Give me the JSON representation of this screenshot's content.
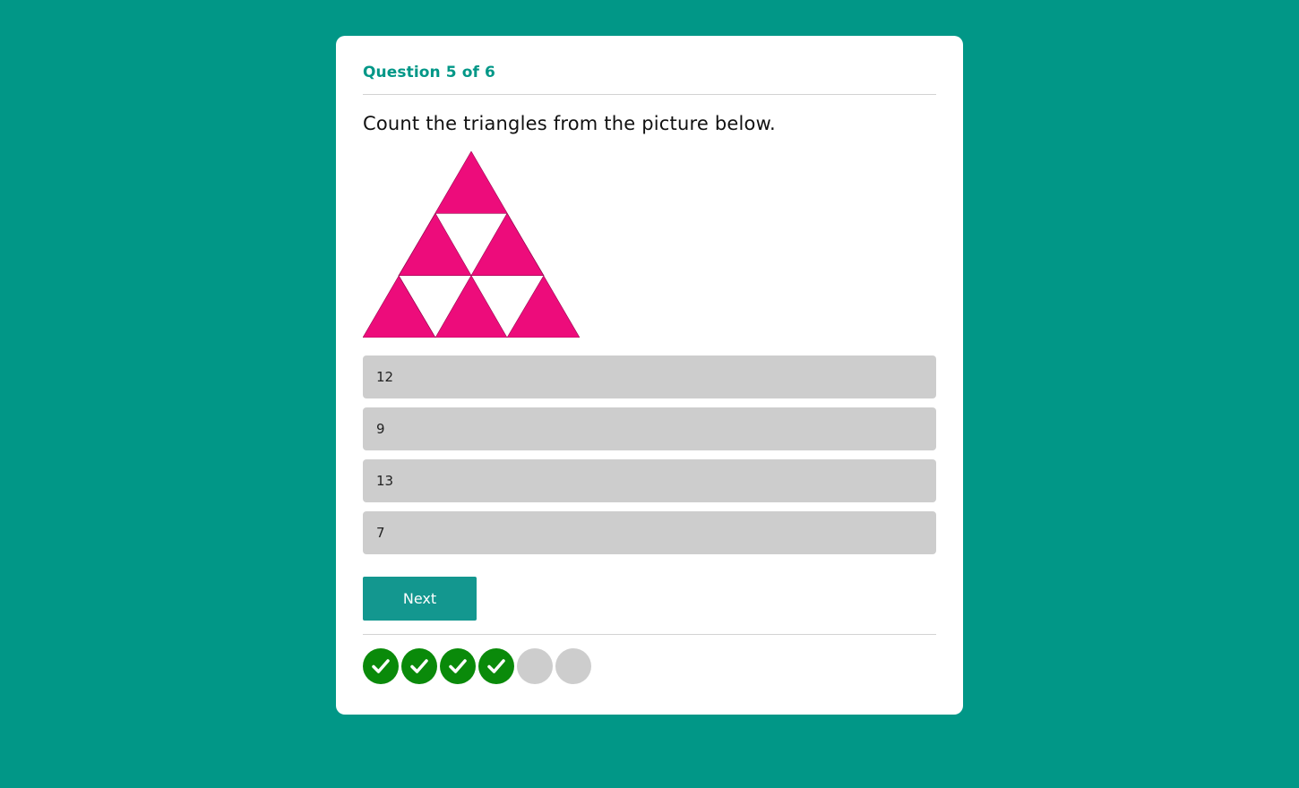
{
  "quiz": {
    "progress_label": "Question 5 of 6",
    "question": "Count the triangles from the picture below.",
    "figure": {
      "fill_color": "#ed0c7b",
      "hole_color": "#ffffff"
    },
    "answers": [
      {
        "label": "12"
      },
      {
        "label": "9"
      },
      {
        "label": "13"
      },
      {
        "label": "7"
      }
    ],
    "next_label": "Next",
    "progress": [
      {
        "status": "correct",
        "icon": "check-icon"
      },
      {
        "status": "correct",
        "icon": "check-icon"
      },
      {
        "status": "correct",
        "icon": "check-icon"
      },
      {
        "status": "correct",
        "icon": "check-icon"
      },
      {
        "status": "pending"
      },
      {
        "status": "pending"
      }
    ]
  },
  "colors": {
    "background": "#019787",
    "accent": "#019787",
    "correct": "#0a8a0a",
    "pending": "#cdcdcd",
    "answer_bg": "#cdcdcd"
  }
}
